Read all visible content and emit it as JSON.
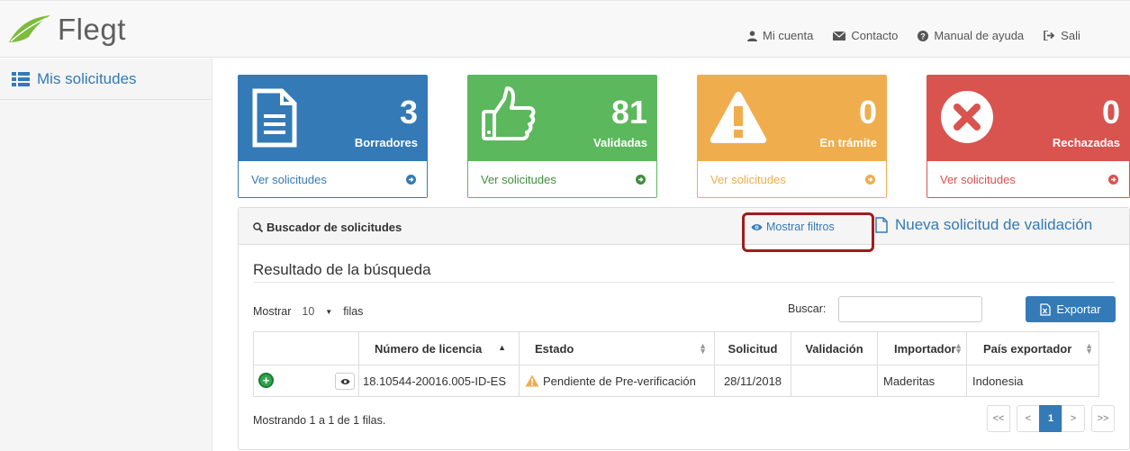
{
  "app": {
    "name": "Flegt",
    "logo_icon": "leaf-icon"
  },
  "topnav": {
    "account": "Mi cuenta",
    "contact": "Contacto",
    "help": "Manual de ayuda",
    "exit": "Sali"
  },
  "sidebar": {
    "items": [
      {
        "label": "Mis solicitudes",
        "icon": "list-icon"
      }
    ]
  },
  "cards": [
    {
      "count": "3",
      "label": "Borradores",
      "link": "Ver solicitudes",
      "icon": "document-icon",
      "color": "#337ab7"
    },
    {
      "count": "81",
      "label": "Validadas",
      "link": "Ver solicitudes",
      "icon": "thumbs-up-icon",
      "color": "#5cb85c"
    },
    {
      "count": "0",
      "label": "En trámite",
      "link": "Ver solicitudes",
      "icon": "warning-icon",
      "color": "#f0ad4e"
    },
    {
      "count": "0",
      "label": "Rechazadas",
      "link": "Ver solicitudes",
      "icon": "times-circle-icon",
      "color": "#d9534f"
    }
  ],
  "panel": {
    "title": "Buscador de solicitudes",
    "show_filters": "Mostrar filtros",
    "new_request": "Nueva solicitud de validación",
    "result_title": "Resultado de la búsqueda",
    "show_label": "Mostrar",
    "page_size": "10",
    "rows_label": "filas",
    "search_label": "Buscar:",
    "search_value": "",
    "export_label": "Exportar",
    "footer": "Mostrando 1 a 1 de 1 filas."
  },
  "table": {
    "headers": [
      "",
      "Número de licencia",
      "Estado",
      "Solicitud",
      "Validación",
      "Importador",
      "País exportador"
    ],
    "rows": [
      {
        "license": "18.10544-20016.005-ID-ES",
        "status": "Pendiente de Pre-verificación",
        "request_date": "28/11/2018",
        "validation": "",
        "importer": "Maderitas",
        "country": "Indonesia"
      }
    ]
  },
  "pager": {
    "first": "<<",
    "prev": "<",
    "current": "1",
    "next": ">",
    "last": ">>"
  }
}
